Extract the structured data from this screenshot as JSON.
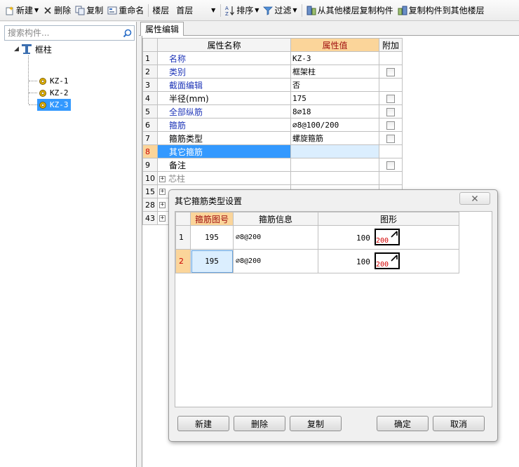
{
  "toolbar": {
    "new_label": "新建",
    "delete_label": "删除",
    "copy_label": "复制",
    "rename_label": "重命名",
    "floor_label": "楼层",
    "floor_value": "首层",
    "sort_label": "排序",
    "filter_label": "过滤",
    "copy_from_floor_label": "从其他楼层复制构件",
    "copy_to_floor_label": "复制构件到其他楼层"
  },
  "left_panel": {
    "search_placeholder": "搜索构件...",
    "tree": {
      "root_label": "框柱",
      "items": [
        {
          "label": "KZ-1"
        },
        {
          "label": "KZ-2"
        },
        {
          "label": "KZ-3",
          "selected": true
        }
      ]
    }
  },
  "main": {
    "tab_label": "属性编辑",
    "table": {
      "headers": {
        "name": "属性名称",
        "value": "属性值",
        "extra": "附加"
      },
      "rows": [
        {
          "num": "1",
          "name": "名称",
          "value": "KZ-3"
        },
        {
          "num": "2",
          "name": "类别",
          "value": "框架柱"
        },
        {
          "num": "3",
          "name": "截面编辑",
          "value": "否"
        },
        {
          "num": "4",
          "name": "半径(mm)",
          "value": "175"
        },
        {
          "num": "5",
          "name": "全部纵筋",
          "value": "8⌀18"
        },
        {
          "num": "6",
          "name": "箍筋",
          "value": "⌀8@100/200"
        },
        {
          "num": "7",
          "name": "箍筋类型",
          "value": "螺旋箍筋"
        },
        {
          "num": "8",
          "name": "其它箍筋",
          "value": ""
        },
        {
          "num": "9",
          "name": "备注",
          "value": ""
        },
        {
          "num": "10",
          "name": "芯柱",
          "value": ""
        },
        {
          "num": "15",
          "name": "",
          "value": ""
        },
        {
          "num": "28",
          "name": "",
          "value": ""
        },
        {
          "num": "43",
          "name": "",
          "value": ""
        }
      ]
    }
  },
  "dialog": {
    "title": "其它箍筋类型设置",
    "headers": {
      "code": "箍筋图号",
      "info": "箍筋信息",
      "shape": "图形"
    },
    "rows": [
      {
        "num": "1",
        "code": "195",
        "info": "⌀8@200",
        "shape_value": "100",
        "shape_label": "200"
      },
      {
        "num": "2",
        "code": "195",
        "info": "⌀8@200",
        "shape_value": "100",
        "shape_label": "200"
      }
    ],
    "buttons": {
      "new": "新建",
      "delete": "删除",
      "copy": "复制",
      "ok": "确定",
      "cancel": "取消"
    }
  },
  "colors": {
    "selection_blue": "#3399ff",
    "header_highlight": "#fbd59a",
    "property_blue": "#1f36b8",
    "shape_red": "#d40000"
  }
}
